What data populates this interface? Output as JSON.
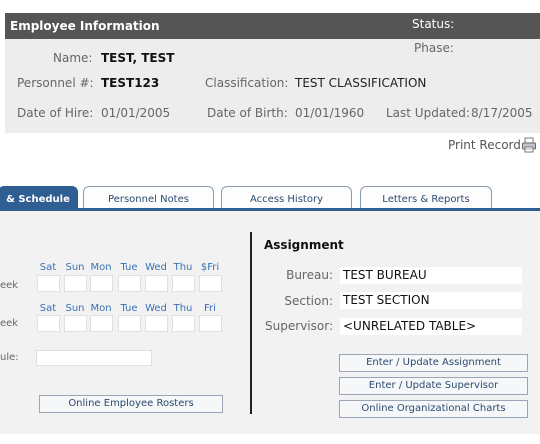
{
  "header": {
    "title": "Employee Information",
    "status_label": "Status:",
    "phase_label": "Phase:",
    "name_label": "Name:",
    "name_value": "TEST, TEST",
    "personnel_label": "Personnel #:",
    "personnel_value": "TEST123",
    "classification_label": "Classification:",
    "classification_value": "TEST CLASSIFICATION",
    "hire_label": "Date of Hire:",
    "hire_value": "01/01/2005",
    "birth_label": "Date of Birth:",
    "birth_value": "01/01/1960",
    "updated_label": "Last Updated:",
    "updated_value": "8/17/2005"
  },
  "print_record": "Print Record",
  "tabs": [
    {
      "label": "& Schedule",
      "active": true
    },
    {
      "label": "Personnel Notes",
      "active": false
    },
    {
      "label": "Access History",
      "active": false
    },
    {
      "label": "Letters & Reports",
      "active": false
    }
  ],
  "schedule": {
    "row1_days": [
      "Sat",
      "Sun",
      "Mon",
      "Tue",
      "Wed",
      "Thu",
      "$Fri"
    ],
    "row2_days": [
      "Sat",
      "Sun",
      "Mon",
      "Tue",
      "Wed",
      "Thu",
      "Fri"
    ],
    "row1_label": "eek",
    "row2_label": "eek",
    "row3_label": "ule:",
    "rosters_button": "Online Employee Rosters"
  },
  "assignment": {
    "title": "Assignment",
    "bureau_label": "Bureau:",
    "bureau_value": "TEST BUREAU",
    "section_label": "Section:",
    "section_value": "TEST SECTION",
    "supervisor_label": "Supervisor:",
    "supervisor_value": "<UNRELATED TABLE>",
    "btn_assignment": "Enter / Update Assignment",
    "btn_supervisor": "Enter / Update Supervisor",
    "btn_org_charts": "Online Organizational Charts"
  },
  "colors": {
    "header_bar": "#555555",
    "tab_active": "#2f5e92",
    "link_text": "#2b4a70",
    "day_text": "#3a72b5"
  }
}
